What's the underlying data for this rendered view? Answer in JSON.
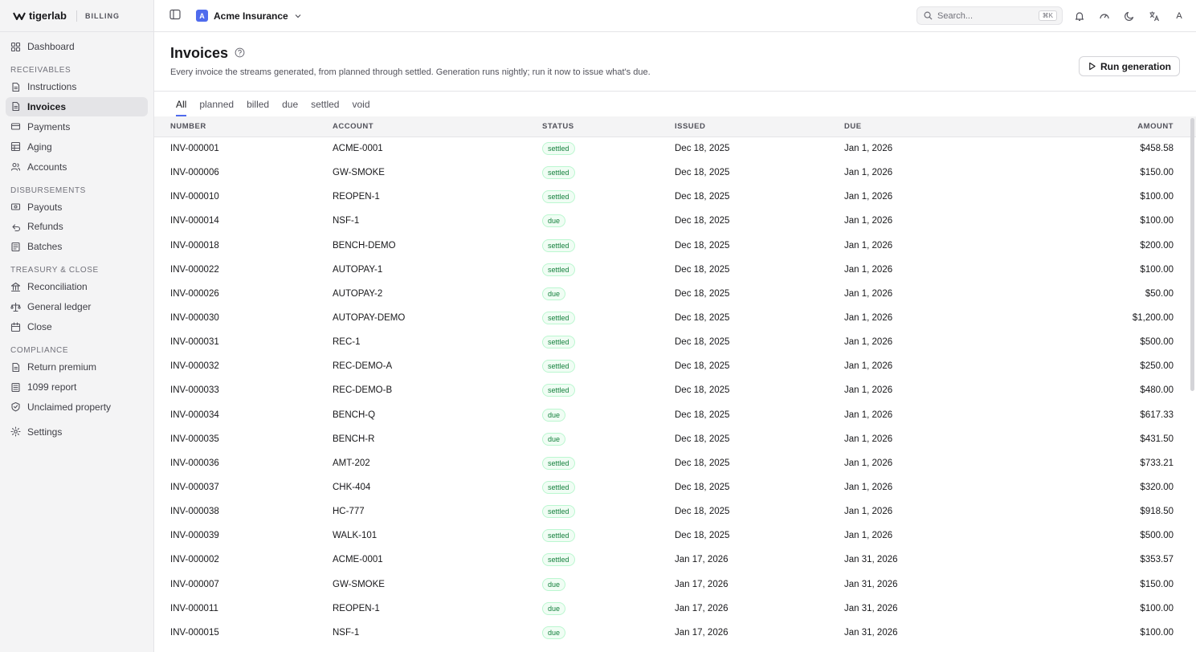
{
  "brand": {
    "name": "tigerlab",
    "sub": "BILLING"
  },
  "sidebar": {
    "top": [
      {
        "label": "Dashboard"
      }
    ],
    "sections": [
      {
        "title": "RECEIVABLES",
        "items": [
          {
            "label": "Instructions"
          },
          {
            "label": "Invoices"
          },
          {
            "label": "Payments"
          },
          {
            "label": "Aging"
          },
          {
            "label": "Accounts"
          }
        ]
      },
      {
        "title": "DISBURSEMENTS",
        "items": [
          {
            "label": "Payouts"
          },
          {
            "label": "Refunds"
          },
          {
            "label": "Batches"
          }
        ]
      },
      {
        "title": "TREASURY & CLOSE",
        "items": [
          {
            "label": "Reconciliation"
          },
          {
            "label": "General ledger"
          },
          {
            "label": "Close"
          }
        ]
      },
      {
        "title": "COMPLIANCE",
        "items": [
          {
            "label": "Return premium"
          },
          {
            "label": "1099 report"
          },
          {
            "label": "Unclaimed property"
          }
        ]
      }
    ],
    "bottom": [
      {
        "label": "Settings"
      }
    ],
    "active": "Invoices"
  },
  "topbar": {
    "org_initial": "A",
    "org_name": "Acme Insurance",
    "search_placeholder": "Search...",
    "search_shortcut": "⌘K",
    "avatar": "A"
  },
  "page": {
    "title": "Invoices",
    "subtitle": "Every invoice the streams generated, from planned through settled. Generation runs nightly; run it now to issue what's due.",
    "run_label": "Run generation"
  },
  "tabs": [
    "All",
    "planned",
    "billed",
    "due",
    "settled",
    "void"
  ],
  "active_tab": "All",
  "table": {
    "columns": [
      "NUMBER",
      "ACCOUNT",
      "STATUS",
      "ISSUED",
      "DUE",
      "AMOUNT"
    ],
    "rows": [
      {
        "number": "INV-000001",
        "account": "ACME-0001",
        "status": "settled",
        "issued": "Dec 18, 2025",
        "due": "Jan 1, 2026",
        "amount": "$458.58"
      },
      {
        "number": "INV-000006",
        "account": "GW-SMOKE",
        "status": "settled",
        "issued": "Dec 18, 2025",
        "due": "Jan 1, 2026",
        "amount": "$150.00"
      },
      {
        "number": "INV-000010",
        "account": "REOPEN-1",
        "status": "settled",
        "issued": "Dec 18, 2025",
        "due": "Jan 1, 2026",
        "amount": "$100.00"
      },
      {
        "number": "INV-000014",
        "account": "NSF-1",
        "status": "due",
        "issued": "Dec 18, 2025",
        "due": "Jan 1, 2026",
        "amount": "$100.00"
      },
      {
        "number": "INV-000018",
        "account": "BENCH-DEMO",
        "status": "settled",
        "issued": "Dec 18, 2025",
        "due": "Jan 1, 2026",
        "amount": "$200.00"
      },
      {
        "number": "INV-000022",
        "account": "AUTOPAY-1",
        "status": "settled",
        "issued": "Dec 18, 2025",
        "due": "Jan 1, 2026",
        "amount": "$100.00"
      },
      {
        "number": "INV-000026",
        "account": "AUTOPAY-2",
        "status": "due",
        "issued": "Dec 18, 2025",
        "due": "Jan 1, 2026",
        "amount": "$50.00"
      },
      {
        "number": "INV-000030",
        "account": "AUTOPAY-DEMO",
        "status": "settled",
        "issued": "Dec 18, 2025",
        "due": "Jan 1, 2026",
        "amount": "$1,200.00"
      },
      {
        "number": "INV-000031",
        "account": "REC-1",
        "status": "settled",
        "issued": "Dec 18, 2025",
        "due": "Jan 1, 2026",
        "amount": "$500.00"
      },
      {
        "number": "INV-000032",
        "account": "REC-DEMO-A",
        "status": "settled",
        "issued": "Dec 18, 2025",
        "due": "Jan 1, 2026",
        "amount": "$250.00"
      },
      {
        "number": "INV-000033",
        "account": "REC-DEMO-B",
        "status": "settled",
        "issued": "Dec 18, 2025",
        "due": "Jan 1, 2026",
        "amount": "$480.00"
      },
      {
        "number": "INV-000034",
        "account": "BENCH-Q",
        "status": "due",
        "issued": "Dec 18, 2025",
        "due": "Jan 1, 2026",
        "amount": "$617.33"
      },
      {
        "number": "INV-000035",
        "account": "BENCH-R",
        "status": "due",
        "issued": "Dec 18, 2025",
        "due": "Jan 1, 2026",
        "amount": "$431.50"
      },
      {
        "number": "INV-000036",
        "account": "AMT-202",
        "status": "settled",
        "issued": "Dec 18, 2025",
        "due": "Jan 1, 2026",
        "amount": "$733.21"
      },
      {
        "number": "INV-000037",
        "account": "CHK-404",
        "status": "settled",
        "issued": "Dec 18, 2025",
        "due": "Jan 1, 2026",
        "amount": "$320.00"
      },
      {
        "number": "INV-000038",
        "account": "HC-777",
        "status": "settled",
        "issued": "Dec 18, 2025",
        "due": "Jan 1, 2026",
        "amount": "$918.50"
      },
      {
        "number": "INV-000039",
        "account": "WALK-101",
        "status": "settled",
        "issued": "Dec 18, 2025",
        "due": "Jan 1, 2026",
        "amount": "$500.00"
      },
      {
        "number": "INV-000002",
        "account": "ACME-0001",
        "status": "settled",
        "issued": "Jan 17, 2026",
        "due": "Jan 31, 2026",
        "amount": "$353.57"
      },
      {
        "number": "INV-000007",
        "account": "GW-SMOKE",
        "status": "due",
        "issued": "Jan 17, 2026",
        "due": "Jan 31, 2026",
        "amount": "$150.00"
      },
      {
        "number": "INV-000011",
        "account": "REOPEN-1",
        "status": "due",
        "issued": "Jan 17, 2026",
        "due": "Jan 31, 2026",
        "amount": "$100.00"
      },
      {
        "number": "INV-000015",
        "account": "NSF-1",
        "status": "due",
        "issued": "Jan 17, 2026",
        "due": "Jan 31, 2026",
        "amount": "$100.00"
      }
    ]
  },
  "colors": {
    "accent": "#4f6bed",
    "badge_text": "#15803d",
    "badge_border": "#bbf7d0",
    "badge_bg": "#f0fdf4",
    "sidebar_bg": "#f4f4f5"
  }
}
